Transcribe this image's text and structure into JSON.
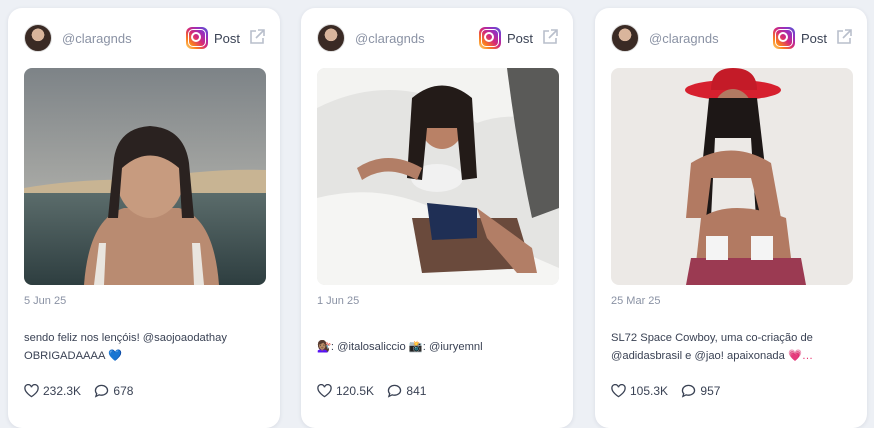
{
  "posts": [
    {
      "handle": "@claragnds",
      "post_label": "Post",
      "date": "5 Jun 25",
      "caption_text": "sendo feliz nos lençóis! @saojoaodathay OBRIGADAAAA",
      "caption_emoji": "💙",
      "likes": "232.3K",
      "comments": "678"
    },
    {
      "handle": "@claragnds",
      "post_label": "Post",
      "date": "1 Jun 25",
      "caption_text": "💇🏽‍♀️: @italosaliccio 📸: @iuryemnl",
      "caption_emoji": "",
      "likes": "120.5K",
      "comments": "841"
    },
    {
      "handle": "@claragnds",
      "post_label": "Post",
      "date": "25 Mar 25",
      "caption_text": "SL72 Space Cowboy, uma co-criação de @adidasbrasil e @jao! apaixonada",
      "caption_emoji": "💗…",
      "likes": "105.3K",
      "comments": "957"
    }
  ],
  "icons": {
    "platform": "instagram-icon",
    "open": "external-link-icon",
    "likes": "heart-icon",
    "comments": "comment-icon"
  }
}
